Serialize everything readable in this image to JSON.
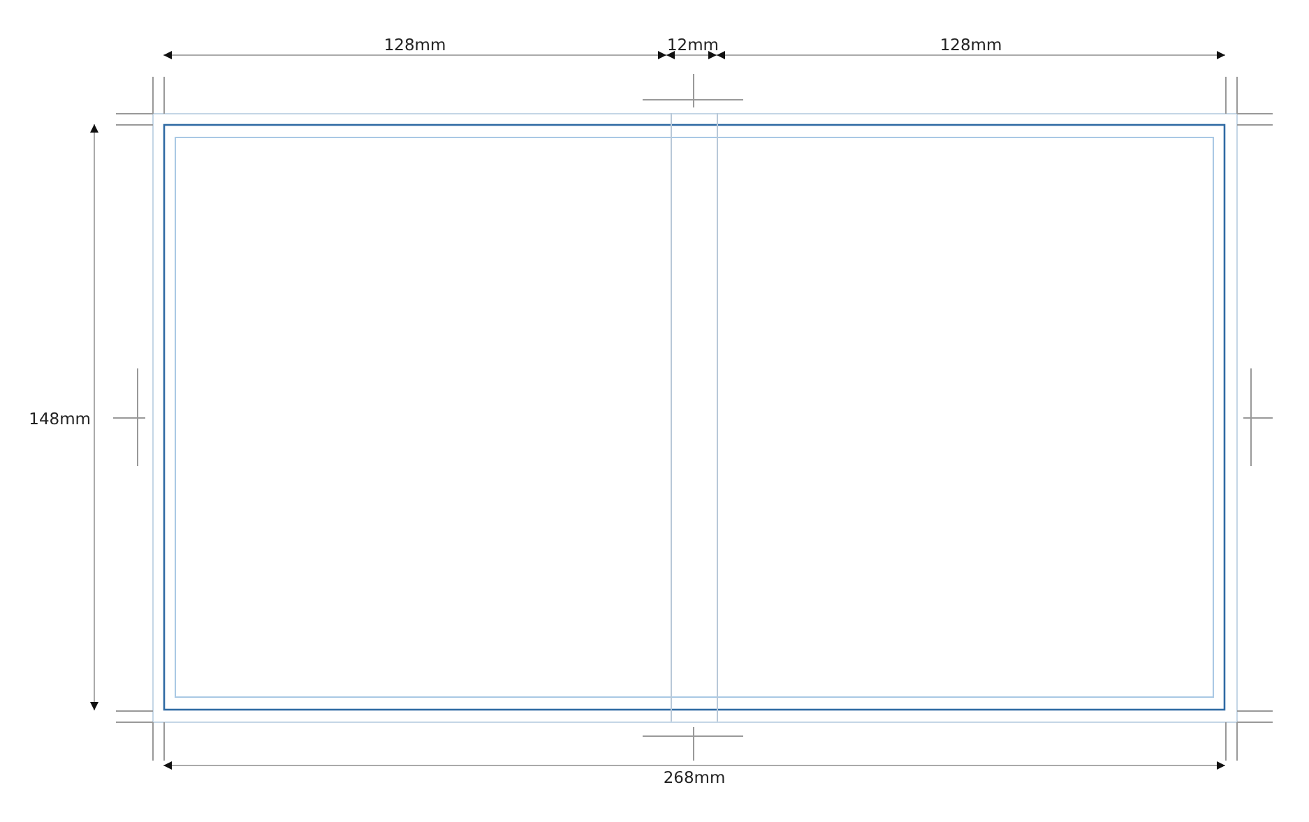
{
  "top_dimensions": [
    {
      "label": "128mm"
    },
    {
      "label": "12mm"
    },
    {
      "label": "128mm"
    }
  ],
  "height_dimension": {
    "label": "148mm"
  },
  "width_dimension": {
    "label": "268mm"
  }
}
